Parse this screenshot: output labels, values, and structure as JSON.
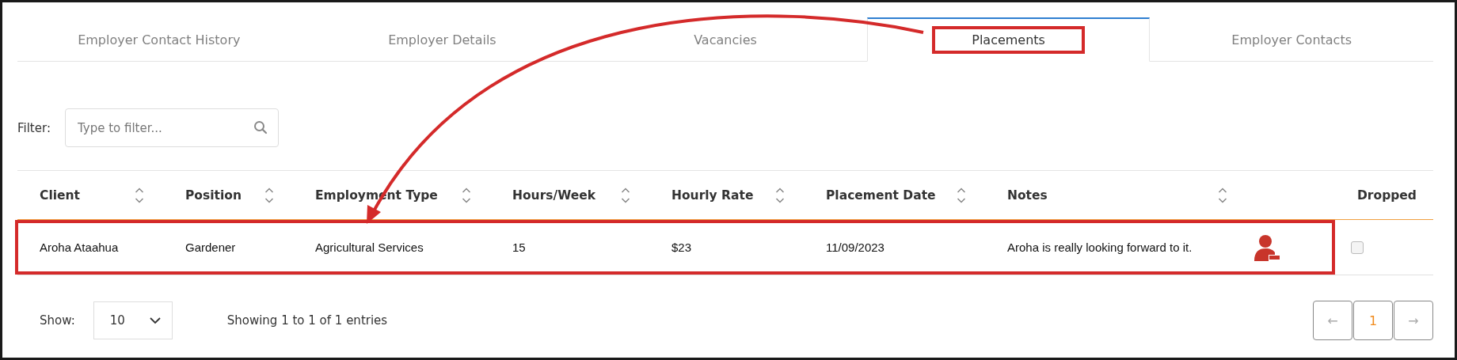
{
  "tabs": [
    {
      "label": "Employer Contact History",
      "selected": false,
      "highlighted": false
    },
    {
      "label": "Employer Details",
      "selected": false,
      "highlighted": false
    },
    {
      "label": "Vacancies",
      "selected": false,
      "highlighted": false
    },
    {
      "label": "Placements",
      "selected": true,
      "highlighted": true
    },
    {
      "label": "Employer Contacts",
      "selected": false,
      "highlighted": false
    }
  ],
  "filter": {
    "label": "Filter:",
    "placeholder": "Type to filter..."
  },
  "table": {
    "columns": [
      {
        "label": "Client",
        "sortable": true
      },
      {
        "label": "Position",
        "sortable": true
      },
      {
        "label": "Employment Type",
        "sortable": true
      },
      {
        "label": "Hours/Week",
        "sortable": true
      },
      {
        "label": "Hourly Rate",
        "sortable": true
      },
      {
        "label": "Placement Date",
        "sortable": true
      },
      {
        "label": "Notes",
        "sortable": true
      },
      {
        "label": "Dropped"
      }
    ],
    "rows": [
      {
        "cells": [
          "Aroha Ataahua",
          "Gardener",
          "Agricultural Services",
          "15",
          "$23",
          "11/09/2023",
          "Aroha is really looking forward to it."
        ],
        "dropped": false,
        "highlighted": true
      }
    ]
  },
  "footer": {
    "show_label": "Show:",
    "page_size": "10",
    "summary": "Showing 1 to 1 of 1 entries",
    "pages": [
      {
        "label": "←",
        "selected": false,
        "disabled": true
      },
      {
        "label": "1",
        "selected": true,
        "disabled": false
      },
      {
        "label": "→",
        "selected": false,
        "disabled": true
      }
    ]
  },
  "arrow": true
}
